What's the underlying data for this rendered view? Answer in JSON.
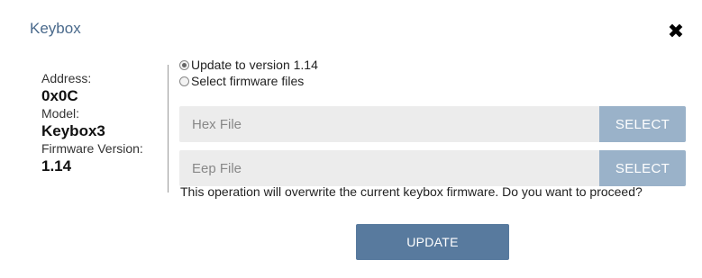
{
  "dialog": {
    "title": "Keybox",
    "close_icon": "close-icon"
  },
  "device": {
    "address_label": "Address:",
    "address_value": "0x0C",
    "model_label": "Model:",
    "model_value": "Keybox3",
    "firmware_label": "Firmware Version:",
    "firmware_value": "1.14"
  },
  "options": {
    "update_version_label": "Update to version 1.14",
    "update_version_selected": true,
    "select_files_label": "Select firmware files",
    "select_files_selected": false
  },
  "files": [
    {
      "placeholder": "Hex File",
      "button_label": "SELECT"
    },
    {
      "placeholder": "Eep File",
      "button_label": "SELECT"
    }
  ],
  "warning_text": "This operation will overwrite the current keybox firmware. Do you want to proceed?",
  "actions": {
    "update_label": "UPDATE"
  },
  "colors": {
    "title": "#4a6a8c",
    "select_button": "#9ab2c9",
    "update_button": "#587a9e",
    "file_field_bg": "#ececec"
  }
}
